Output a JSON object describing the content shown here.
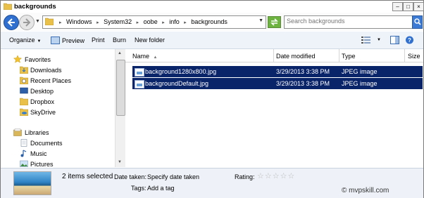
{
  "window": {
    "title": "backgrounds"
  },
  "address": {
    "crumbs": [
      "Windows",
      "System32",
      "oobe",
      "info",
      "backgrounds"
    ]
  },
  "search": {
    "placeholder": "Search backgrounds"
  },
  "toolbar": {
    "organize_label": "Organize",
    "preview_label": "Preview",
    "print_label": "Print",
    "burn_label": "Burn",
    "new_folder_label": "New folder"
  },
  "sidebar": {
    "favorites_label": "Favorites",
    "favorites": [
      "Downloads",
      "Recent Places",
      "Desktop",
      "Dropbox",
      "SkyDrive"
    ],
    "libraries_label": "Libraries",
    "libraries": [
      "Documents",
      "Music",
      "Pictures"
    ]
  },
  "columns": {
    "name": "Name",
    "date": "Date modified",
    "type": "Type",
    "size": "Size"
  },
  "files": [
    {
      "name": "background1280x800.jpg",
      "date": "3/29/2013 3:38 PM",
      "type": "JPEG image"
    },
    {
      "name": "backgroundDefault.jpg",
      "date": "3/29/2013 3:38 PM",
      "type": "JPEG image"
    }
  ],
  "details": {
    "selection": "2 items selected",
    "date_taken_label": "Date taken:",
    "date_taken_value": "Specify date taken",
    "rating_label": "Rating:",
    "tags_label": "Tags:",
    "tags_value": "Add a tag",
    "rating_stars": 5
  },
  "watermark": "© mvpskill.com",
  "colors": {
    "selection": "#0a246a",
    "toolbar_bg": "#eef3fa",
    "accent": "#2f6fd0"
  }
}
